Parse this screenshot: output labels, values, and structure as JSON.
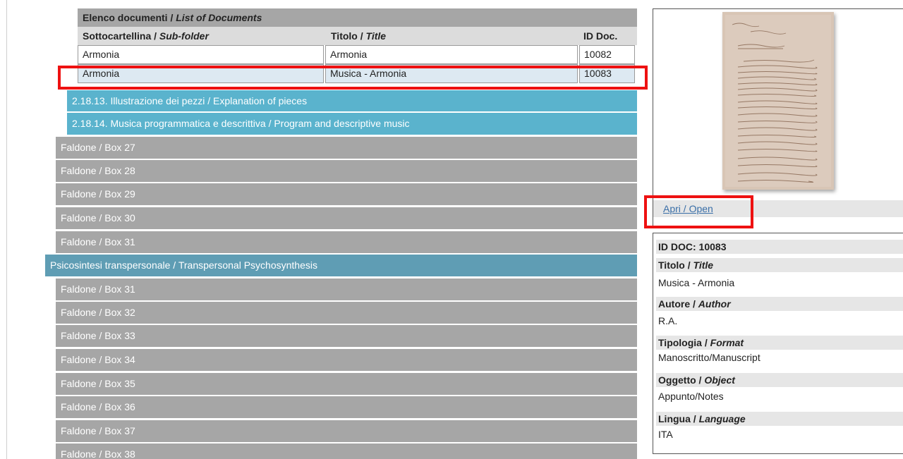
{
  "doc_list": {
    "title_main": "Elenco documenti / ",
    "title_it": "List of Documents",
    "headers": [
      {
        "main": "Sottocartellina / ",
        "it": "Sub-folder"
      },
      {
        "main": "Titolo / ",
        "it": "Title"
      },
      {
        "main": "ID Doc.",
        "it": ""
      }
    ],
    "rows": [
      {
        "subfolder": "Armonia",
        "title": "Armonia",
        "id": "10082"
      },
      {
        "subfolder": "Armonia",
        "title": "Musica - Armonia",
        "id": "10083"
      }
    ]
  },
  "tree": {
    "subs": [
      "2.18.13. Illustrazione dei pezzi / Explanation of pieces",
      "2.18.14. Musica programmatica e descrittiva / Program and descriptive music"
    ],
    "boxes_a": [
      "Faldone / Box 27",
      "Faldone / Box 28",
      "Faldone / Box 29",
      "Faldone / Box 30",
      "Faldone / Box 31"
    ],
    "category": "Psicosintesi transpersonale / Transpersonal Psychosynthesis",
    "boxes_b": [
      "Faldone / Box 31",
      "Faldone / Box 32",
      "Faldone / Box 33",
      "Faldone / Box 34",
      "Faldone / Box 35",
      "Faldone / Box 36",
      "Faldone / Box 37",
      "Faldone / Box 38"
    ]
  },
  "preview": {
    "open_link": "Apri / Open"
  },
  "details": {
    "id_label": "ID DOC: 10083",
    "fields": [
      {
        "label": "Titolo / ",
        "label_it": "Title",
        "value": "Musica - Armonia"
      },
      {
        "label": "Autore / ",
        "label_it": "Author",
        "value": "R.A."
      },
      {
        "label": "Tipologia / ",
        "label_it": "Format",
        "value": "Manoscritto/Manuscript"
      },
      {
        "label": "Oggetto / ",
        "label_it": "Object",
        "value": "Appunto/Notes"
      },
      {
        "label": "Lingua / ",
        "label_it": "Language",
        "value": "ITA"
      }
    ]
  },
  "colors": {
    "subfolder_row": "#5ab3cd",
    "box_row": "#a6a6a6",
    "category_row": "#5f9db4",
    "highlight": "#ee1111"
  }
}
